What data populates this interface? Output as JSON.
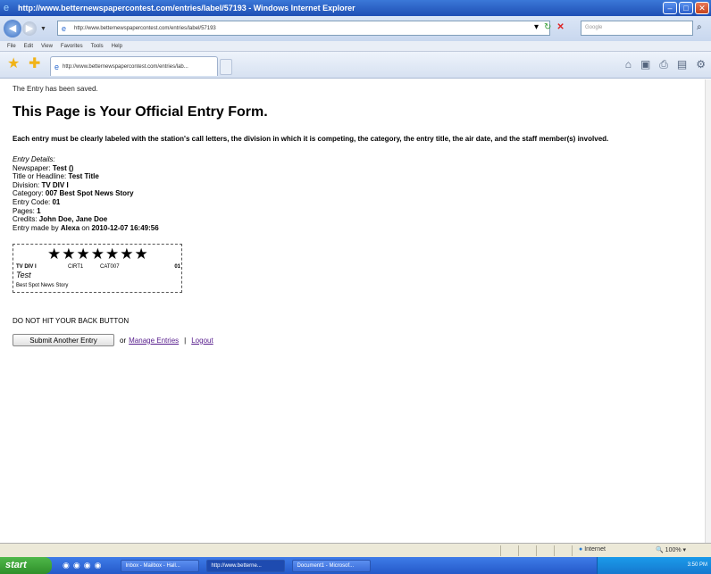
{
  "window": {
    "title": "http://www.betternewspapercontest.com/entries/label/57193 - Windows Internet Explorer",
    "min": "–",
    "max": "□",
    "close": "✕"
  },
  "address": {
    "url": "http://www.betternewspapercontest.com/entries/label/57193",
    "search_placeholder": "Google"
  },
  "menu": [
    "File",
    "Edit",
    "View",
    "Favorites",
    "Tools",
    "Help"
  ],
  "tab": {
    "label": "http://www.betternewspapercontest.com/entries/lab..."
  },
  "page": {
    "saved": "The Entry has been saved.",
    "heading": "This Page is Your Official Entry Form.",
    "instructions": "Each entry must be clearly labeled with the station's call letters, the division in which it is competing, the category, the entry title, the air date, and the staff member(s) involved.",
    "details_head": "Entry Details:",
    "details": [
      {
        "label": "Newspaper: ",
        "value": "Test ()"
      },
      {
        "label": "Title or Headline: ",
        "value": "Test Title"
      },
      {
        "label": "Division: ",
        "value": "TV DIV I"
      },
      {
        "label": "Category: ",
        "value": "007 Best Spot News Story"
      },
      {
        "label": "Entry Code: ",
        "value": "01"
      },
      {
        "label": "Pages: ",
        "value": "1"
      },
      {
        "label": "Credits: ",
        "value": "John Doe, Jane Doe"
      }
    ],
    "entry_made_prefix": "Entry made by ",
    "entry_made_user": "Alexa",
    "entry_made_on": " on ",
    "entry_made_date": "2010-12-07 16:49:56",
    "label": {
      "stars": "★★★★★★★",
      "division": "TV DIV I",
      "cirt": "CIRT1",
      "cat": "CAT007",
      "code": "01",
      "title": "Test",
      "category": "Best Spot News Story"
    },
    "warning": "DO NOT HIT YOUR BACK BUTTON",
    "submit_button": "Submit Another Entry",
    "or_text": "or",
    "manage_link": "Manage Entries",
    "separator": "|",
    "logout_link": "Logout"
  },
  "status": {
    "zone": "Internet",
    "zoom": "100%"
  },
  "taskbar": {
    "start": "start",
    "tasks": [
      "Inbox - Mailbox - Hall...",
      "http://www.betterne...",
      "Document1 - Microsof..."
    ],
    "clock": "3:50 PM"
  }
}
